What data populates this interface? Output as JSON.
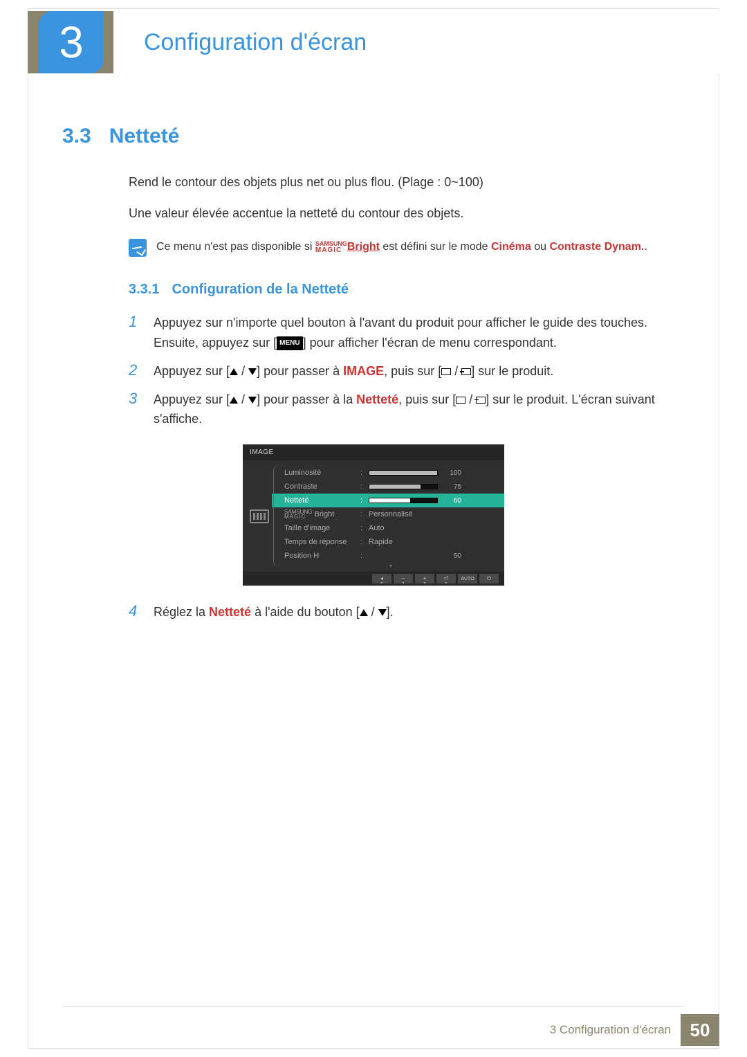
{
  "chapter": {
    "number": "3",
    "title": "Configuration d'écran"
  },
  "section": {
    "number": "3.3",
    "title": "Netteté"
  },
  "intro_p1": "Rend le contour des objets plus net ou plus flou. (Plage : 0~100)",
  "intro_p2": "Une valeur élevée accentue la netteté du contour des objets.",
  "note": {
    "pre": "Ce menu n'est pas disponible si ",
    "samsung_top": "SAMSUNG",
    "samsung_bot": "MAGIC",
    "bright": "Bright",
    "mid": " est défini sur le mode ",
    "cinema": "Cinéma",
    "or": " ou ",
    "contrast": "Contraste Dynam.",
    "end": "."
  },
  "subsection": {
    "number": "3.3.1",
    "title": "Configuration de la Netteté"
  },
  "steps": {
    "s1": {
      "a": "Appuyez sur n'importe quel bouton à l'avant du produit pour afficher le guide des touches. Ensuite, appuyez sur [",
      "menu": "MENU",
      "b": "] pour afficher l'écran de menu correspondant."
    },
    "s2": {
      "a": "Appuyez sur [",
      "b": "] pour passer à ",
      "image": "IMAGE",
      "c": ", puis sur [",
      "d": "] sur le produit."
    },
    "s3": {
      "a": "Appuyez sur [",
      "b": "] pour passer à la ",
      "nettete": "Netteté",
      "c": ", puis sur [",
      "d": "] sur le produit. L'écran suivant s'affiche."
    },
    "s4": {
      "a": "Réglez la ",
      "nettete": "Netteté",
      "b": " à l'aide du bouton [",
      "c": "]."
    }
  },
  "osd": {
    "title": "IMAGE",
    "rows": [
      {
        "label": "Luminosité",
        "bar": 100,
        "num": "100"
      },
      {
        "label": "Contraste",
        "bar": 75,
        "num": "75"
      },
      {
        "label": "Netteté",
        "bar": 60,
        "num": "60",
        "selected": true
      },
      {
        "label_top": "SAMSUNG",
        "label_bot": "MAGIC",
        "label_suffix": " Bright",
        "value": "Personnalisé"
      },
      {
        "label": "Taille d'image",
        "value": "Auto"
      },
      {
        "label": "Temps de réponse",
        "value": "Rapide"
      },
      {
        "label": "Position H",
        "bar": 50,
        "num": "50",
        "nobar_fill": true
      }
    ],
    "footer_auto": "AUTO"
  },
  "footer": {
    "text": "3 Configuration d'écran",
    "page": "50"
  }
}
